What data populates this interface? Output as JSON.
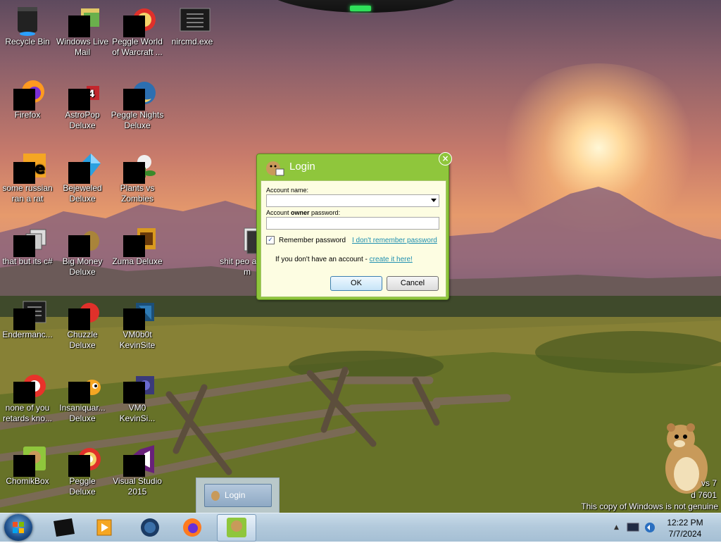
{
  "desktop": {
    "icons": [
      {
        "label": "Recycle Bin"
      },
      {
        "label": "Windows Live Mail"
      },
      {
        "label": "Peggle World of Warcraft ..."
      },
      {
        "label": "nircmd.exe"
      },
      {
        "label": "Firefox"
      },
      {
        "label": "AstroPop Deluxe"
      },
      {
        "label": "Peggle Nights Deluxe"
      },
      {
        "label": "some russian ran a rat"
      },
      {
        "label": "Bejeweled Deluxe"
      },
      {
        "label": "Plants vs Zombies"
      },
      {
        "label": "that but its c#"
      },
      {
        "label": "Big Money Deluxe"
      },
      {
        "label": "Zuma Deluxe"
      },
      {
        "label": "shit peo asked m"
      },
      {
        "label": "Endermanc..."
      },
      {
        "label": "Chuzzle Deluxe"
      },
      {
        "label": "VM0b0t KevinSite"
      },
      {
        "label": "none of you retards kno..."
      },
      {
        "label": "Insaniquar... Deluxe"
      },
      {
        "label": "VM0 KevinSi..."
      },
      {
        "label": "ChomikBox"
      },
      {
        "label": "Peggle Deluxe"
      },
      {
        "label": "Visual Studio 2015"
      }
    ],
    "watermark": {
      "line1": "vs 7",
      "line2": "d 7601",
      "line3": "This copy of Windows is not genuine"
    }
  },
  "dialog": {
    "title": "Login",
    "account_name_label": "Account name:",
    "owner_password_label_pre": "Account ",
    "owner_password_label_bold": "owner",
    "owner_password_label_post": " password:",
    "account_name_value": "",
    "password_value": "",
    "remember_label": "Remember password",
    "remember_checked": true,
    "forgot_link": "I don't remember password",
    "no_account_text": "If you don't have an account - ",
    "create_link": "create it here!",
    "ok_label": "OK",
    "cancel_label": "Cancel"
  },
  "taskbar_preview": {
    "label": "Login"
  },
  "taskbar": {
    "clock_time": "12:22 PM",
    "clock_date": "7/7/2024",
    "pinned": [
      "cmd-icon",
      "media-player-icon",
      "browser-icon",
      "firefox-icon",
      "chomikbox-icon"
    ]
  },
  "colors": {
    "dialog_green": "#8fc63c",
    "dialog_body": "#fdfde2",
    "link": "#1f8fb0",
    "taskbar": "#b3cadc"
  }
}
